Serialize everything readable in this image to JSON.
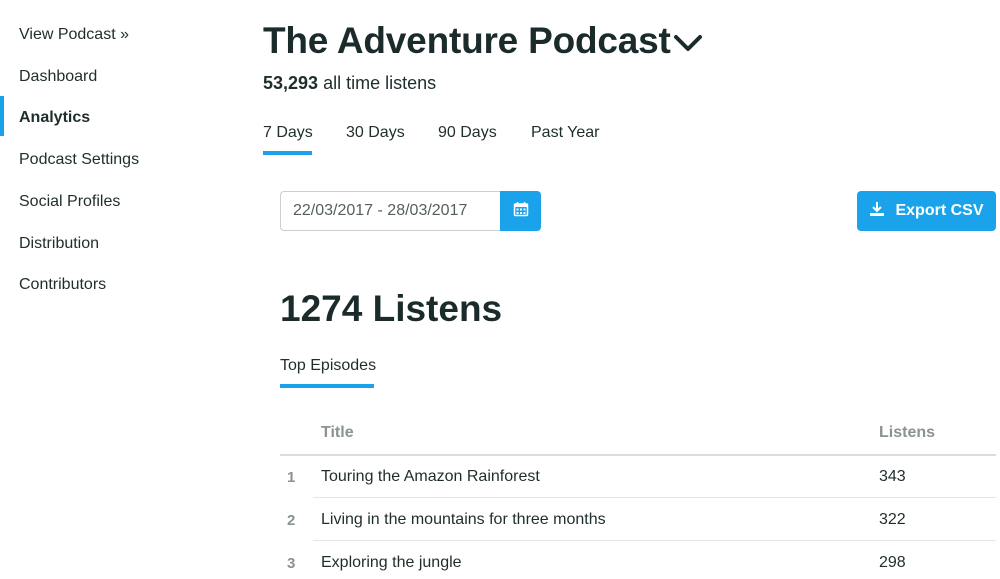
{
  "sidebar": {
    "items": [
      {
        "label": "View Podcast »"
      },
      {
        "label": "Dashboard"
      },
      {
        "label": "Analytics"
      },
      {
        "label": "Podcast Settings"
      },
      {
        "label": "Social Profiles"
      },
      {
        "label": "Distribution"
      },
      {
        "label": "Contributors"
      }
    ],
    "active": "Analytics"
  },
  "header": {
    "title": "The Adventure Podcast",
    "all_time_listens": "53,293",
    "all_time_suffix": "all time listens"
  },
  "range_tabs": [
    {
      "label": "7 Days"
    },
    {
      "label": "30 Days"
    },
    {
      "label": "90 Days"
    },
    {
      "label": "Past Year"
    }
  ],
  "selected_range": "7 Days",
  "date_range": {
    "value": "22/03/2017 - 28/03/2017"
  },
  "export": {
    "label": "Export CSV"
  },
  "total": {
    "text": "1274 Listens"
  },
  "episodes_tab": {
    "label": "Top Episodes"
  },
  "table": {
    "columns": {
      "title": "Title",
      "listens": "Listens"
    },
    "rows": [
      {
        "rank": "1",
        "title": "Touring the Amazon Rainforest",
        "listens": "343"
      },
      {
        "rank": "2",
        "title": "Living in the mountains for three months",
        "listens": "322"
      },
      {
        "rank": "3",
        "title": "Exploring the jungle",
        "listens": "298"
      }
    ]
  },
  "colors": {
    "accent": "#1aa3ea",
    "text": "#1f2d2d",
    "muted": "#8a9294"
  },
  "icons": {
    "title_dropdown": "chevron-down-icon",
    "date": "calendar-icon",
    "export": "download-icon"
  }
}
